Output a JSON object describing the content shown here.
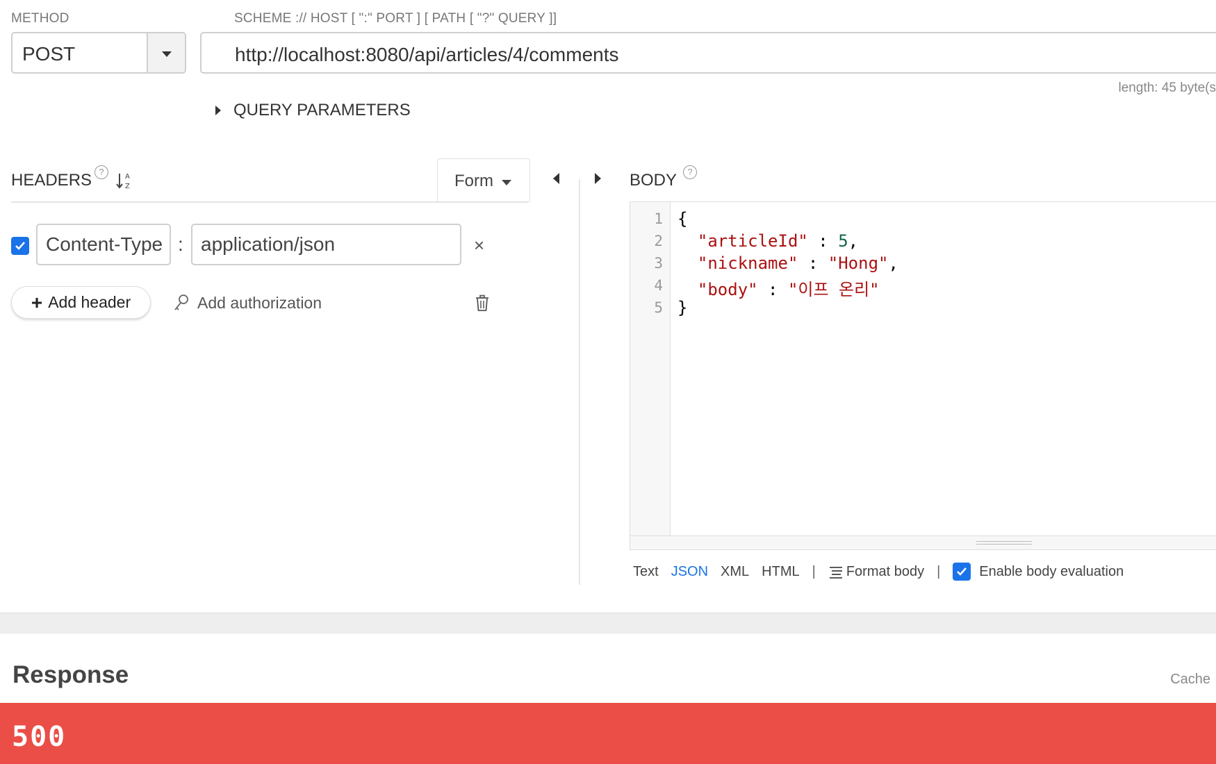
{
  "method": {
    "label": "METHOD",
    "value": "POST"
  },
  "url": {
    "label": "SCHEME :// HOST [ \":\" PORT ] [ PATH [ \"?\" QUERY ]]",
    "value": "http://localhost:8080/api/articles/4/comments",
    "length_text": "length: 45 byte(s"
  },
  "query_parameters": {
    "label": "QUERY PARAMETERS"
  },
  "headers": {
    "title": "HEADERS",
    "help": "?",
    "mode_label": "Form",
    "rows": [
      {
        "enabled": true,
        "name": "Content-Type",
        "value": "application/json"
      }
    ],
    "separator": ":",
    "remove_glyph": "×",
    "add_header_label": "Add header",
    "add_auth_label": "Add authorization"
  },
  "body": {
    "title": "BODY",
    "help": "?",
    "line_numbers": [
      "1",
      "2",
      "3",
      "4",
      "5"
    ],
    "code_lines": [
      "{",
      "  \"articleId\" : 5,",
      "  \"nickname\" : \"Hong\",",
      "  \"body\" : \"이프 온리\"",
      "}"
    ],
    "format_options": [
      "Text",
      "JSON",
      "XML",
      "HTML"
    ],
    "active_format": "JSON",
    "format_body_label": "Format body",
    "enable_eval_label": "Enable body evaluation",
    "enable_eval_checked": true
  },
  "response": {
    "title": "Response",
    "cache_label": "Cache",
    "status_code": "500",
    "status_color": "#ea4e47"
  },
  "colors": {
    "accent": "#1a73e8",
    "error": "#ea4e47"
  }
}
